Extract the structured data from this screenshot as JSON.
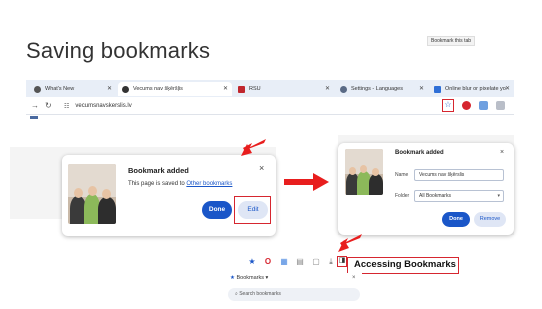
{
  "slide": {
    "title": "Saving bookmarks"
  },
  "browser": {
    "tabs": [
      {
        "label": "What's New",
        "color": "#555555"
      },
      {
        "label": "Vecums nav šķēršļis",
        "color": "#333333"
      },
      {
        "label": "RSU",
        "color": "#c0262d"
      },
      {
        "label": "Settings - Languages",
        "color": "#5a6a85"
      },
      {
        "label": "Online blur or pixelate yo",
        "color": "#2f6fd6"
      }
    ],
    "address": "vecumsnavskerslis.lv",
    "tooltip": "Bookmark this tab"
  },
  "bookmark_added_dialog": {
    "title": "Bookmark added",
    "message_prefix": "This page is saved to ",
    "message_link": "Other bookmarks",
    "done_label": "Done",
    "edit_label": "Edit",
    "close_label": "×"
  },
  "edit_dialog": {
    "title": "Bookmark added",
    "name_label": "Name",
    "name_value": "Vecums nav šķērslis",
    "folder_label": "Folder",
    "folder_value": "All Bookmarks",
    "done_label": "Done",
    "remove_label": "Remove",
    "close_label": "×"
  },
  "bookmarks_panel": {
    "callout": "Accessing Bookmarks",
    "header": "Bookmarks",
    "search_placeholder": "Search bookmarks",
    "close_label": "×"
  },
  "colors": {
    "accent": "#1a56c8",
    "highlight_red": "#d6262f"
  }
}
